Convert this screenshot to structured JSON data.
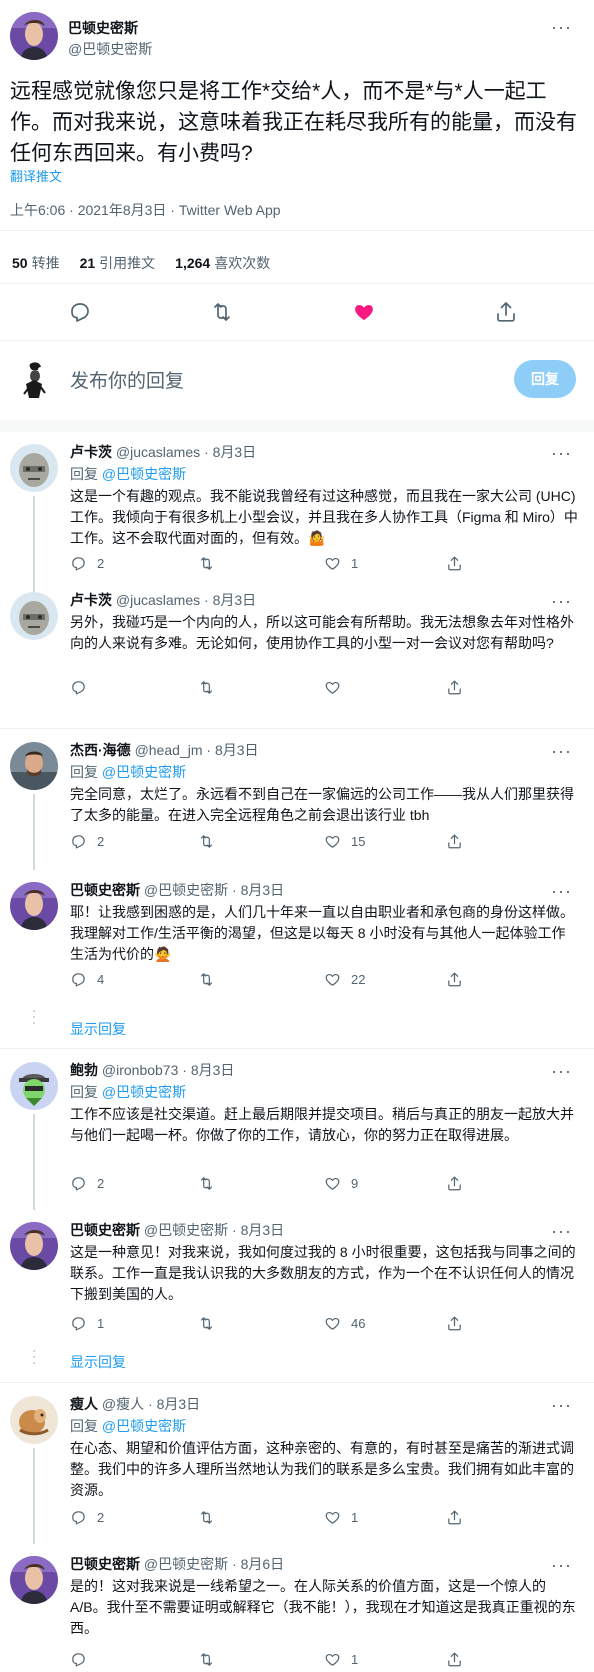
{
  "main_tweet": {
    "name": "巴顿史密斯",
    "handle": "@巴顿史密斯",
    "text": "远程感觉就像您只是将工作*交给*人，而不是*与*人一起工作。而对我来说，这意味着我正在耗尽我所有的能量，而没有任何东西回来。有小费吗?",
    "translate": "翻译推文",
    "meta": "上午6:06 · 2021年8月3日 · Twitter Web App",
    "stats": [
      {
        "value": "50",
        "label": "转推"
      },
      {
        "value": "21",
        "label": "引用推文"
      },
      {
        "value": "1,264",
        "label": "喜欢次数"
      }
    ]
  },
  "compose": {
    "placeholder": "发布你的回复",
    "button": "回复"
  },
  "reply_prefix": "回复",
  "show_replies": "显示回复",
  "colors": {
    "accent": "#1d9bf0",
    "like": "#f91880",
    "muted": "#536471"
  },
  "replies": [
    {
      "name": "卢卡茨",
      "handle": "@jucaslames",
      "date": "8月3日",
      "reply_to": "@巴顿史密斯",
      "text": "这是一个有趣的观点。我不能说我曾经有过这种感觉，而且我在一家大公司 (UHC) 工作。我倾向于有很多机上小型会议，并且我在多人协作工具（Figma 和 Miro）中工作。这不会取代面对面的，但有效。🤷",
      "replies": "2",
      "likes": "1"
    },
    {
      "name": "卢卡茨",
      "handle": "@jucaslames",
      "date": "8月3日",
      "text": "另外，我碰巧是一个内向的人，所以这可能会有所帮助。我无法想象去年对性格外向的人来说有多难。无论如何，使用协作工具的小型一对一会议对您有帮助吗?",
      "replies": "",
      "likes": ""
    },
    {
      "name": "杰西·海德",
      "handle": "@head_jm",
      "date": "8月3日",
      "reply_to": "@巴顿史密斯",
      "text": "完全同意，太烂了。永远看不到自己在一家偏远的公司工作——我从人们那里获得了太多的能量。在进入完全远程角色之前会退出该行业 tbh",
      "replies": "2",
      "likes": "15"
    },
    {
      "name": "巴顿史密斯",
      "handle": "@巴顿史密斯",
      "date": "8月3日",
      "text": "耶！让我感到困惑的是，人们几十年来一直以自由职业者和承包商的身份这样做。我理解对工作/生活平衡的渴望，但这是以每天 8 小时没有与其他人一起体验工作生活为代价的🙅",
      "replies": "4",
      "likes": "22"
    },
    {
      "name": "鲍勃",
      "handle": "@ironbob73",
      "date": "8月3日",
      "reply_to": "@巴顿史密斯",
      "text": "工作不应该是社交渠道。赶上最后期限并提交项目。稍后与真正的朋友一起放大并与他们一起喝一杯。你做了你的工作，请放心，你的努力正在取得进展。",
      "replies": "2",
      "likes": "9"
    },
    {
      "name": "巴顿史密斯",
      "handle": "@巴顿史密斯",
      "date": "8月3日",
      "text": "这是一种意见！对我来说，我如何度过我的 8 小时很重要，这包括我与同事之间的联系。工作一直是我认识我的大多数朋友的方式，作为一个在不认识任何人的情况下搬到美国的人。",
      "replies": "1",
      "likes": "46"
    },
    {
      "name": "瘦人",
      "handle": "@瘦人",
      "date": "8月3日",
      "reply_to": "@巴顿史密斯",
      "text": "在心态、期望和价值评估方面，这种亲密的、有意的，有时甚至是痛苦的渐进式调整。我们中的许多人理所当然地认为我们的联系是多么宝贵。我们拥有如此丰富的资源。",
      "replies": "2",
      "likes": "1"
    },
    {
      "name": "巴顿史密斯",
      "handle": "@巴顿史密斯",
      "date": "8月6日",
      "text": "是的！这对我来说是一线希望之一。在人际关系的价值方面，这是一个惊人的 A/B。我什至不需要证明或解释它（我不能！），我现在才知道这是我真正重视的东西。",
      "replies": "",
      "likes": "1"
    }
  ]
}
